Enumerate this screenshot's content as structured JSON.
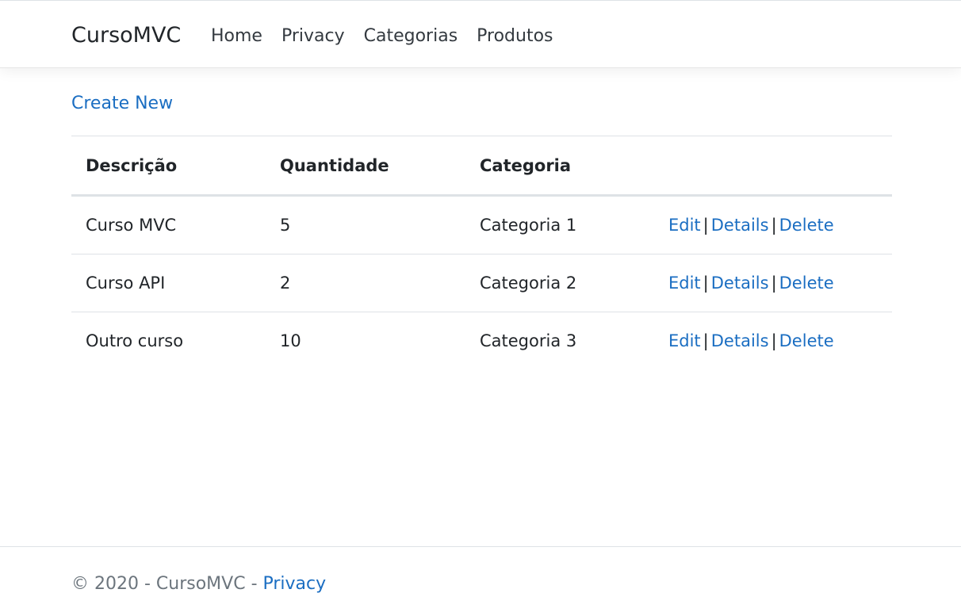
{
  "navbar": {
    "brand": "CursoMVC",
    "links": [
      "Home",
      "Privacy",
      "Categorias",
      "Produtos"
    ]
  },
  "actions": {
    "create_new": "Create New"
  },
  "table": {
    "headers": [
      "Descrição",
      "Quantidade",
      "Categoria"
    ],
    "rows": [
      {
        "descricao": "Curso MVC",
        "quantidade": "5",
        "categoria": "Categoria 1"
      },
      {
        "descricao": "Curso API",
        "quantidade": "2",
        "categoria": "Categoria 2"
      },
      {
        "descricao": "Outro curso",
        "quantidade": "10",
        "categoria": "Categoria 3"
      }
    ],
    "row_actions": {
      "edit": "Edit",
      "details": "Details",
      "delete": "Delete",
      "separator": "|"
    }
  },
  "footer": {
    "text": "© 2020 - CursoMVC - ",
    "privacy_link": "Privacy"
  },
  "colors": {
    "link": "#1b6ec2",
    "text": "#212529",
    "muted": "#6c757d",
    "border": "#dee2e6"
  }
}
